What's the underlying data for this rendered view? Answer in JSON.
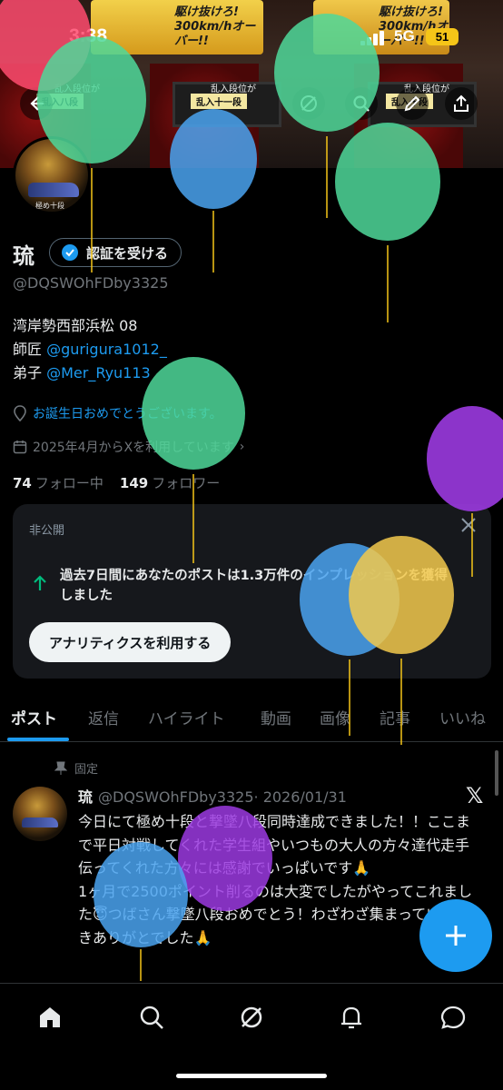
{
  "status_bar": {
    "time": "3:38",
    "network": "5G",
    "battery": "51"
  },
  "banner": {
    "sign_left": "駆け抜けろ!\n300km/hオーバー!!",
    "sign_right": "駆け抜けろ!\n300km/hオーバー!!",
    "screen_left_note": "乱入段位が",
    "screen_left_tag": "乱入十一段",
    "screen_right_note": "乱入段位が",
    "screen_right_tag": "乱入十段",
    "screen_far_left_note": "乱入段位が",
    "screen_far_left_tag": "乱入八段"
  },
  "profile": {
    "avatar_caption": "極め十段",
    "name": "琉",
    "verify_label": "認証を受ける",
    "handle": "@DQSWOhFDby3325",
    "bio_line1": "湾岸勢西部浜松 08",
    "bio_line2_prefix": "師匠 ",
    "bio_line2_link": "@gurigura1012_",
    "bio_line3_prefix": "弟子 ",
    "bio_line3_link": "@Mer_Ryu113",
    "birthday": "お誕生日おめでとうございます。",
    "joined": "2025年4月からXを利用しています",
    "following_count": "74",
    "following_label": "フォロー中",
    "followers_count": "149",
    "followers_label": "フォロワー"
  },
  "analytics_card": {
    "private_label": "非公開",
    "message": "過去7日間にあなたのポストは1.3万件のインプレッションを獲得しました",
    "cta": "アナリティクスを利用する"
  },
  "tabs": [
    "ポスト",
    "返信",
    "ハイライト",
    "動画",
    "画像",
    "記事",
    "いいね"
  ],
  "pinned_post": {
    "pinned_label": "固定",
    "author_name": "琉",
    "author_handle": "@DQSWOhFDby3325",
    "date": "· 2026/01/31",
    "text": "今日にて極め十段と撃墜八段同時達成できました！！ここまで平日対戦してくれた学生組やいつもの大人の方々達代走手伝ってくれた方々には感謝でいっぱいです🙏\n1ヶ月で2500ポイント削るのは大変でしたがやってこれました😇つばさん撃墜八段おめでとう！わざわざ集まっていただきありがとでした🙏"
  },
  "colors": {
    "accent": "#1d9bf0",
    "background": "#000000",
    "card": "#16181c",
    "muted": "#71767b"
  }
}
